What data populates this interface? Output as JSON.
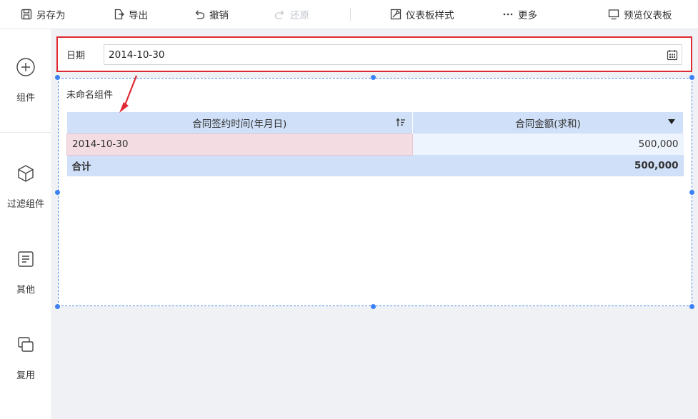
{
  "toolbar": {
    "save_as": "另存为",
    "export": "导出",
    "undo": "撤销",
    "redo": "还原",
    "dashboard_style": "仪表板样式",
    "more": "更多",
    "preview": "预览仪表板"
  },
  "sidebar": {
    "items": [
      {
        "label": "组件",
        "icon": "plus-circle-icon"
      },
      {
        "label": "过滤组件",
        "icon": "cube-icon"
      },
      {
        "label": "其他",
        "icon": "text-doc-icon"
      },
      {
        "label": "复用",
        "icon": "stack-icon"
      }
    ]
  },
  "filter": {
    "label": "日期",
    "value": "2014-10-30"
  },
  "widget": {
    "title": "未命名组件",
    "table": {
      "columns": [
        "合同签约时间(年月日)",
        "合同金额(求和)"
      ],
      "rows": [
        {
          "date": "2014-10-30",
          "amount": "500,000"
        }
      ],
      "total_label": "合计",
      "total_amount": "500,000"
    }
  },
  "colors": {
    "highlight_border": "#e02a33",
    "header_bg": "#cfe0f8",
    "selection": "#4a86e8",
    "canvas_bg": "#f0f1f4"
  }
}
